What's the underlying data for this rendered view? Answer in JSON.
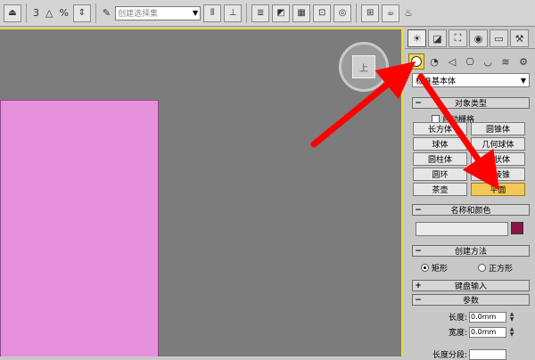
{
  "toolbar": {
    "selection_set_placeholder": "创建选择集",
    "glyph_3": "3",
    "glyph_percent": "%"
  },
  "viewport": {
    "viewcube_label": "上",
    "object_color": "#e68fdb",
    "border_color": "#e8d84c"
  },
  "panel": {
    "tabs": [
      "create-icon",
      "modify-icon",
      "hierarchy-icon",
      "motion-icon",
      "display-icon",
      "utilities-icon"
    ],
    "categories": [
      "geometry-icon",
      "shapes-icon",
      "lights-icon",
      "cameras-icon",
      "helpers-icon",
      "spacewarps-icon",
      "systems-icon"
    ],
    "type_dropdown": "标准基本体",
    "object_type": {
      "title": "对象类型",
      "autogrid": "自动栅格",
      "buttons": [
        "长方体",
        "圆锥体",
        "球体",
        "几何球体",
        "圆柱体",
        "管状体",
        "圆环",
        "四棱锥",
        "茶壶",
        "平面"
      ],
      "active": "平面"
    },
    "name_color": {
      "title": "名称和颜色",
      "name_value": "",
      "color": "#8e1545"
    },
    "creation_method": {
      "title": "创建方法",
      "option_rect": "矩形",
      "option_square": "正方形"
    },
    "keyboard_entry": {
      "title": "键盘输入"
    },
    "parameters": {
      "title": "参数",
      "length_label": "长度:",
      "length_value": "0.0mm",
      "width_label": "宽度:",
      "width_value": "0.0mm",
      "length_segs_label": "长度分段:"
    }
  },
  "annotation_color": "#ff0000"
}
